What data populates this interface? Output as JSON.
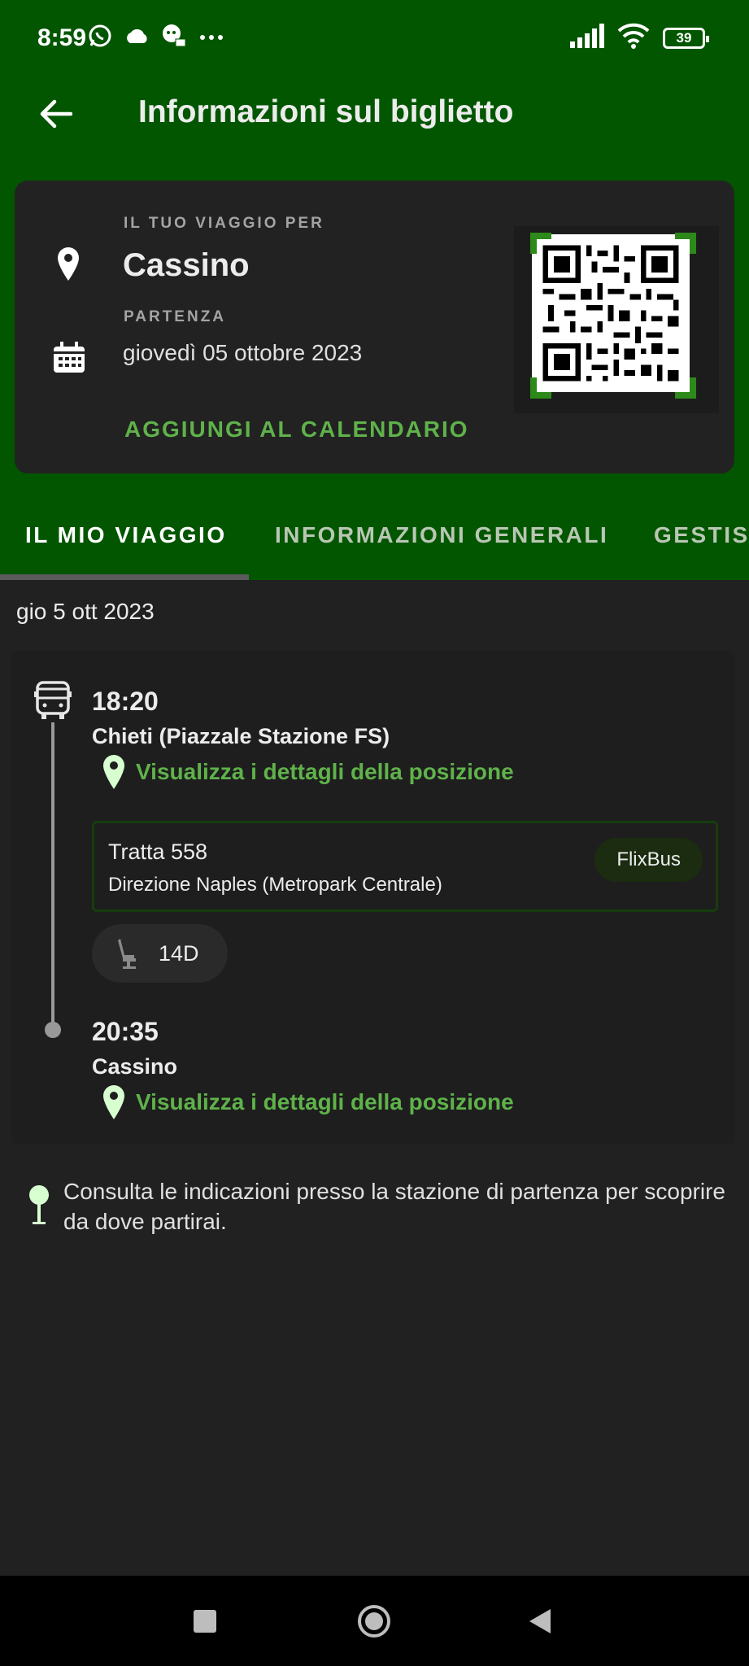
{
  "status": {
    "time": "8:59",
    "battery": "39"
  },
  "appbar": {
    "title": "Informazioni sul biglietto"
  },
  "ticket": {
    "trip_label": "IL TUO VIAGGIO PER",
    "destination": "Cassino",
    "departure_label": "PARTENZA",
    "departure_date": "giovedì 05 ottobre 2023",
    "add_calendar": "AGGIUNGI AL CALENDARIO"
  },
  "tabs": [
    {
      "label": "IL MIO VIAGGIO",
      "active": true
    },
    {
      "label": "INFORMAZIONI GENERALI",
      "active": false
    },
    {
      "label": "GESTIS",
      "active": false
    }
  ],
  "trip": {
    "date": "gio 5 ott 2023",
    "departure_time": "18:20",
    "departure_stop": "Chieti (Piazzale Stazione FS)",
    "location_link": "Visualizza i dettagli della posizione",
    "route_name": "Tratta 558",
    "route_direction": "Direzione Naples (Metropark Centrale)",
    "operator": "FlixBus",
    "seat": "14D",
    "arrival_time": "20:35",
    "arrival_stop": "Cassino"
  },
  "hint": "Consulta le indicazioni presso la stazione di partenza per scoprire da dove partirai.",
  "colors": {
    "primary_green": "#035600",
    "accent_green": "#5fb24a",
    "background": "#212121"
  }
}
